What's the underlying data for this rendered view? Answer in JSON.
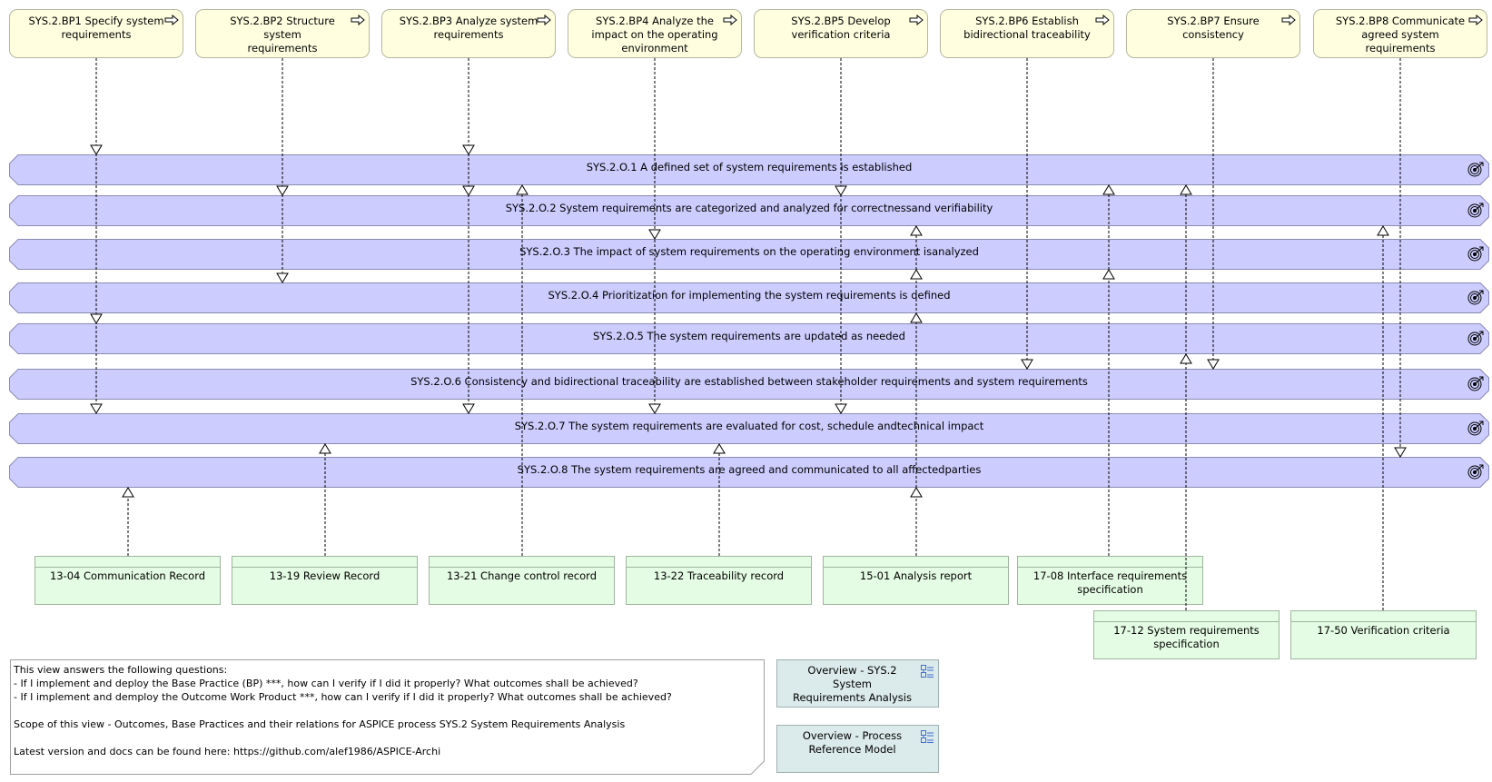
{
  "diagram": {
    "base_practices": [
      {
        "id": "BP1",
        "label": "SYS.2.BP1 Specify system requirements",
        "lines": [
          "SYS.2.BP1 Specify system",
          "requirements"
        ]
      },
      {
        "id": "BP2",
        "label": "SYS.2.BP2 Structure system requirements",
        "lines": [
          "SYS.2.BP2 Structure system",
          "requirements"
        ]
      },
      {
        "id": "BP3",
        "label": "SYS.2.BP3 Analyze system requirements",
        "lines": [
          "SYS.2.BP3 Analyze system",
          "requirements"
        ]
      },
      {
        "id": "BP4",
        "label": "SYS.2.BP4 Analyze the impact on the operating environment",
        "lines": [
          "SYS.2.BP4 Analyze the",
          "impact on the operating",
          "environment"
        ]
      },
      {
        "id": "BP5",
        "label": "SYS.2.BP5 Develop verification criteria",
        "lines": [
          "SYS.2.BP5 Develop",
          "verification criteria"
        ]
      },
      {
        "id": "BP6",
        "label": "SYS.2.BP6 Establish bidirectional traceability",
        "lines": [
          "SYS.2.BP6 Establish",
          "bidirectional traceability"
        ]
      },
      {
        "id": "BP7",
        "label": "SYS.2.BP7 Ensure consistency",
        "lines": [
          "SYS.2.BP7 Ensure",
          "consistency"
        ]
      },
      {
        "id": "BP8",
        "label": "SYS.2.BP8 Communicate agreed system requirements",
        "lines": [
          "SYS.2.BP8 Communicate",
          "agreed system requirements"
        ]
      }
    ],
    "outcomes": [
      {
        "id": "O1",
        "label": "SYS.2.O.1 A defined set of system requirements is established"
      },
      {
        "id": "O2",
        "label": "SYS.2.O.2 System requirements are categorized and analyzed for correctnessand verifiability"
      },
      {
        "id": "O3",
        "label": "SYS.2.O.3 The impact of system requirements on the operating environment isanalyzed"
      },
      {
        "id": "O4",
        "label": "SYS.2.O.4 Prioritization for implementing the system requirements is defined"
      },
      {
        "id": "O5",
        "label": "SYS.2.O.5 The system requirements are updated as needed"
      },
      {
        "id": "O6",
        "label": "SYS.2.O.6 Consistency and bidirectional traceability are established between stakeholder requirements and system requirements"
      },
      {
        "id": "O7",
        "label": "SYS.2.O.7 The system requirements are evaluated for cost, schedule andtechnical impact"
      },
      {
        "id": "O8",
        "label": "SYS.2.O.8 The system requirements are agreed and communicated to all affectedparties"
      }
    ],
    "work_products": [
      {
        "id": "WP1304",
        "lines": [
          "13-04 Communication Record"
        ]
      },
      {
        "id": "WP1319",
        "lines": [
          "13-19 Review Record"
        ]
      },
      {
        "id": "WP1321",
        "lines": [
          "13-21 Change control record"
        ]
      },
      {
        "id": "WP1322",
        "lines": [
          "13-22 Traceability record"
        ]
      },
      {
        "id": "WP1501",
        "lines": [
          "15-01 Analysis report"
        ]
      },
      {
        "id": "WP1708",
        "lines": [
          "17-08 Interface requirements",
          "specification"
        ]
      },
      {
        "id": "WP1712",
        "lines": [
          "17-12 System requirements",
          "specification"
        ]
      },
      {
        "id": "WP1750",
        "lines": [
          "17-50 Verification criteria"
        ]
      }
    ],
    "relations": {
      "bp_to_outcome": [
        {
          "from": "BP1",
          "to": [
            "O1",
            "O5",
            "O7"
          ]
        },
        {
          "from": "BP2",
          "to": [
            "O2",
            "O4"
          ]
        },
        {
          "from": "BP3",
          "to": [
            "O1",
            "O2",
            "O7"
          ]
        },
        {
          "from": "BP4",
          "to": [
            "O3",
            "O7"
          ]
        },
        {
          "from": "BP5",
          "to": [
            "O2",
            "O7"
          ]
        },
        {
          "from": "BP6",
          "to": [
            "O6"
          ]
        },
        {
          "from": "BP7",
          "to": [
            "O6"
          ]
        },
        {
          "from": "BP8",
          "to": [
            "O8"
          ]
        }
      ],
      "work_product_to_outcome": [
        {
          "from": "WP1304",
          "to": [
            "O8"
          ]
        },
        {
          "from": "WP1319",
          "to": [
            "O7"
          ]
        },
        {
          "from": "WP1321",
          "to": [
            "O1"
          ]
        },
        {
          "from": "WP1322",
          "to": [
            "O7"
          ]
        },
        {
          "from": "WP1501",
          "to": [
            "O2",
            "O3",
            "O4",
            "O8"
          ]
        },
        {
          "from": "WP1708",
          "to": [
            "O1",
            "O3"
          ]
        },
        {
          "from": "WP1712",
          "to": [
            "O1",
            "O5"
          ]
        },
        {
          "from": "WP1750",
          "to": [
            "O2"
          ]
        }
      ]
    }
  },
  "note": {
    "lines": [
      "This view answers the following questions:",
      "- If I implement and deploy the Base Practice (BP) ***, how can I verify if I did it properly? What outcomes shall be achieved?",
      "- If I implement and demploy the Outcome Work Product ***, how can I verify if I did it properly? What outcomes shall be achieved?",
      "",
      "Scope of this view - Outcomes, Base Practices and their relations for ASPICE process SYS.2 System Requirements Analysis",
      "",
      "Latest version and docs can be found here: https://github.com/alef1986/ASPICE-Archi"
    ]
  },
  "view_references": [
    {
      "lines": [
        "Overview - SYS.2 System",
        "Requirements Analysis"
      ]
    },
    {
      "lines": [
        "Overview - Process",
        "Reference Model"
      ]
    }
  ],
  "colors": {
    "base_practice_fill": "#ffffe0",
    "outcome_fill": "#ccccff",
    "outcome_stroke": "#8a8ab4",
    "work_product_fill": "#e3fce3",
    "view_reference_fill": "#dbeaea",
    "icon_blue": "#3f6fd0"
  }
}
